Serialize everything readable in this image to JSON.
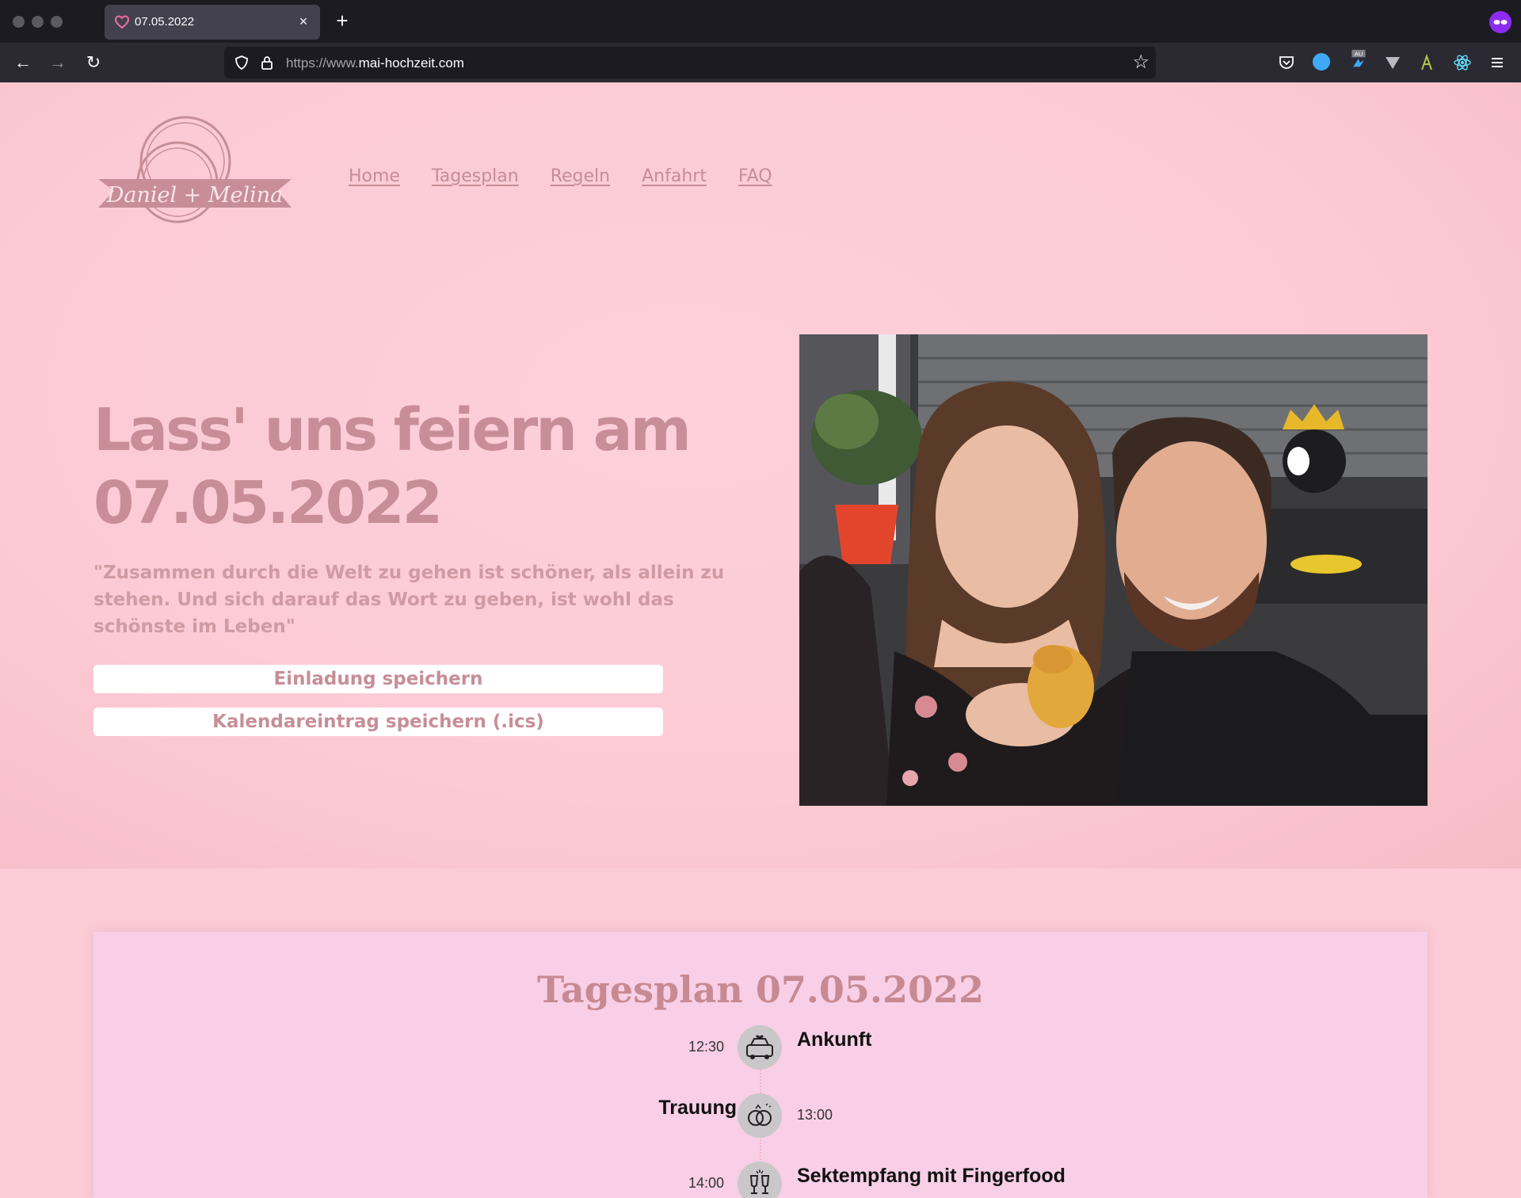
{
  "browser": {
    "tab_title": "07.05.2022",
    "tab_close": "×",
    "new_tab": "+",
    "url_prefix": "https://www.",
    "url_domain": "mai-hochzeit.com",
    "toolbar_icons": [
      "shield-icon",
      "lock-icon",
      "star-icon",
      "pocket-icon",
      "extension-blue-icon",
      "extension-au-icon",
      "extension-v-icon",
      "extension-a-icon",
      "react-devtools-icon",
      "menu-icon"
    ]
  },
  "site": {
    "logo_text": "Daniel + Melina",
    "nav": [
      "Home",
      "Tagesplan",
      "Regeln",
      "Anfahrt",
      "FAQ"
    ],
    "headline_line1": "Lass' uns feiern am",
    "headline_line2": "07.05.2022",
    "quote": "\"Zusammen durch die Welt zu gehen ist schöner, als allein zu stehen. Und sich darauf das Wort zu geben, ist wohl das schönste im Leben\"",
    "button_invite": "Einladung speichern",
    "button_calendar": "Kalendareintrag speichern (.ics)"
  },
  "schedule": {
    "title": "Tagesplan 07.05.2022",
    "items": [
      {
        "time": "12:30",
        "title": "Ankunft",
        "icon": "wedding-car-icon"
      },
      {
        "time": "13:00",
        "title": "Trauung",
        "icon": "wedding-rings-icon"
      },
      {
        "time": "14:00",
        "title": "Sektempfang mit Fingerfood",
        "icon": "champagne-toast-icon"
      }
    ]
  },
  "colors": {
    "accent": "#c78e97",
    "page_bg": "#fcccd6",
    "card_bg": "#f8cfe6",
    "browser_dark": "#1c1b22"
  }
}
